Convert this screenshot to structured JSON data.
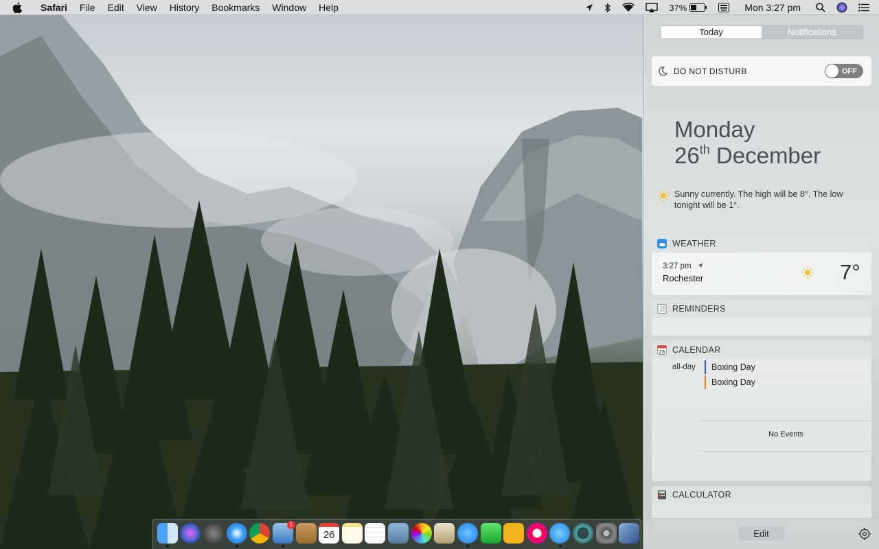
{
  "menubar": {
    "app_name": "Safari",
    "menus": [
      "File",
      "Edit",
      "View",
      "History",
      "Bookmarks",
      "Window",
      "Help"
    ],
    "battery": "37%",
    "clock": "Mon 3:27 pm",
    "status_icons": [
      "location-icon",
      "bluetooth-icon",
      "wifi-icon",
      "airplay-icon",
      "battery-icon",
      "keyboard-icon",
      "spotlight-icon",
      "siri-icon",
      "notification-center-icon"
    ]
  },
  "notification_center": {
    "tabs": [
      "Today",
      "Notifications"
    ],
    "active_tab": "Today",
    "do_not_disturb": {
      "label": "DO NOT DISTURB",
      "state": "OFF"
    },
    "date": {
      "day": "Monday",
      "date_num": "26",
      "ordinal": "th",
      "month": "December"
    },
    "summary": "Sunny currently. The high will be 8°. The low tonight will be 1°.",
    "weather": {
      "title": "WEATHER",
      "time": "3:27 pm",
      "city": "Rochester",
      "temp": "7°"
    },
    "reminders": {
      "title": "REMINDERS"
    },
    "calendar": {
      "title": "CALENDAR",
      "allday_label": "all-day",
      "events": [
        "Boxing Day",
        "Boxing Day"
      ],
      "no_events": "No Events"
    },
    "calculator": {
      "title": "CALCULATOR"
    },
    "edit_label": "Edit"
  },
  "dock": {
    "items": [
      "finder",
      "siri",
      "launchpad",
      "safari",
      "chrome",
      "mail",
      "contacts",
      "calendar",
      "notes",
      "reminders",
      "preview",
      "photos",
      "photo-booth",
      "messages",
      "facetime",
      "vectorize",
      "itunes",
      "app-store",
      "time-machine",
      "system-preferences",
      "virtualbox"
    ],
    "calendar_date": "26",
    "mail_badge": "1"
  },
  "colors": {
    "accent_blue": "#2c5fb0",
    "accent_orange": "#d9822b",
    "badge_red": "#e33333"
  }
}
